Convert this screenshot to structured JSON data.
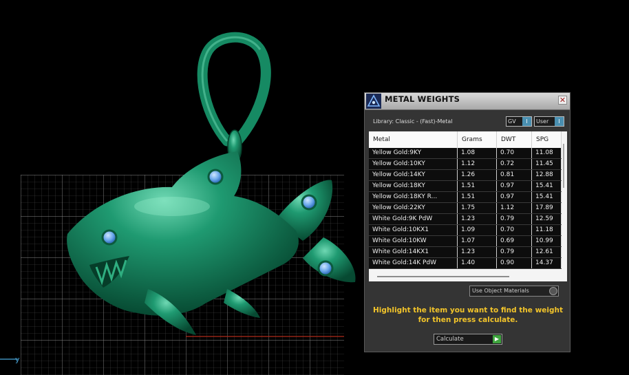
{
  "viewport": {
    "axis_label": "y"
  },
  "panel": {
    "title": "METAL WEIGHTS",
    "close_glyph": "✕",
    "library": "Library: Classic - (Fast)-Metal",
    "gv_label": "GV",
    "user_label": "User",
    "toggle_glyph": "I",
    "columns": [
      "Metal",
      "Grams",
      "DWT",
      "SPG"
    ],
    "rows": [
      {
        "metal": "Yellow Gold:9KY",
        "grams": "1.08",
        "dwt": "0.70",
        "spg": "11.08"
      },
      {
        "metal": "Yellow Gold:10KY",
        "grams": "1.12",
        "dwt": "0.72",
        "spg": "11.45"
      },
      {
        "metal": "Yellow Gold:14KY",
        "grams": "1.26",
        "dwt": "0.81",
        "spg": "12.88"
      },
      {
        "metal": "Yellow Gold:18KY",
        "grams": "1.51",
        "dwt": "0.97",
        "spg": "15.41"
      },
      {
        "metal": "Yellow Gold:18KY R...",
        "grams": "1.51",
        "dwt": "0.97",
        "spg": "15.41"
      },
      {
        "metal": "Yellow Gold:22KY",
        "grams": "1.75",
        "dwt": "1.12",
        "spg": "17.89"
      },
      {
        "metal": "White Gold:9K PdW",
        "grams": "1.23",
        "dwt": "0.79",
        "spg": "12.59"
      },
      {
        "metal": "White Gold:10KX1",
        "grams": "1.09",
        "dwt": "0.70",
        "spg": "11.18"
      },
      {
        "metal": "White Gold:10KW",
        "grams": "1.07",
        "dwt": "0.69",
        "spg": "10.99"
      },
      {
        "metal": "White Gold:14KX1",
        "grams": "1.23",
        "dwt": "0.79",
        "spg": "12.61"
      },
      {
        "metal": "White Gold:14K PdW",
        "grams": "1.40",
        "dwt": "0.90",
        "spg": "14.37"
      }
    ],
    "use_object_materials": "Use Object Materials",
    "message": "Highlight the item you want to find the weight for then press calculate.",
    "calculate_label": "Calculate",
    "calculate_glyph": "▶"
  }
}
